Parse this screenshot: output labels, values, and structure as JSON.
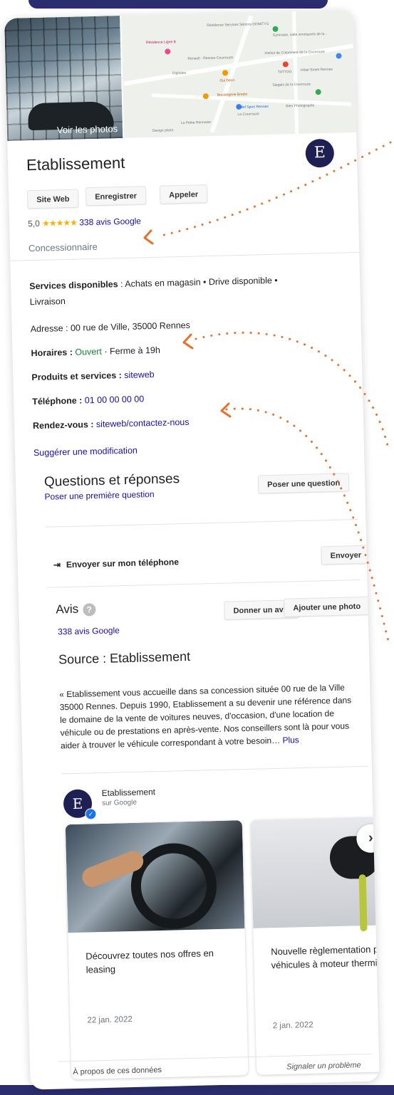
{
  "header": {
    "see_photos": "Voir les photos",
    "title": "Etablissement",
    "logo_letter": "E"
  },
  "map": {
    "labels": [
      "Résidence Ligne B",
      "Résidence Services Séniors DOMITYS",
      "Renault - Rennes Courrouze",
      "Digitales",
      "Institut de Cotonniere de la Courrouze",
      "Gymnase, salle omnisports de la...",
      "TATTOO",
      "Hôtel Street Rennes",
      "Oui Déco",
      "Boulangerie Bredin",
      "Odiel Sport Rennes",
      "La Courrouze",
      "Bien Photographe",
      "La Petite Rennaise",
      "Design photo",
      "Siegels de la Courrouze"
    ]
  },
  "actions": {
    "site_web": "Site Web",
    "enregistrer": "Enregistrer",
    "appeler": "Appeler"
  },
  "rating": {
    "score": "5,0",
    "stars": "★★★★★",
    "reviews_link": "338 avis Google",
    "value": 5.0
  },
  "category": "Concessionnaire",
  "info": {
    "services_label": "Services disponibles",
    "services_value": " : Achats en magasin • Drive disponible •",
    "services_value2": "Livraison",
    "address": "Adresse : 00 rue de Ville, 35000 Rennes",
    "hours_label": "Horaires : ",
    "hours_open": "Ouvert",
    "hours_close": " · Ferme à 19h",
    "products_label": "Produits et services : ",
    "products_value": "siteweb",
    "phone_label": "Téléphone : ",
    "phone_value": "01 00 00 00 00",
    "appointment_label": "Rendez-vous : ",
    "appointment_value": "siteweb/contactez-nous",
    "suggest_edit": "Suggérer une modification"
  },
  "qa": {
    "title": "Questions et réponses",
    "first_question": "Poser une première question",
    "ask_button": "Poser une question"
  },
  "send": {
    "label": "Envoyer sur mon téléphone",
    "button": "Envoyer"
  },
  "reviews": {
    "title": "Avis",
    "help": "?",
    "give_review": "Donner un avis",
    "add_photo": "Ajouter une photo",
    "count_link": "338 avis Google"
  },
  "source": {
    "title": "Source : Etablissement",
    "text": "« Etablissement  vous accueille dans sa concession située 00 rue de la Ville 35000 Rennes. Depuis 1990, Etablissement a su devenir une référence dans le domaine de la vente de voitures neuves, d'occasion, d'une location de véhicule ou de prestations en après-vente. Nos conseillers sont là pour vous aider à trouver le véhicule correspondant à votre besoin… ",
    "more": "Plus"
  },
  "posts": {
    "author": "Etablissement",
    "author_logo": "E",
    "on_google": "sur Google",
    "items": [
      {
        "text": "Découvrez toutes nos offres en leasing",
        "date": "22 jan. 2022"
      },
      {
        "text": "Nouvelle règlementation pour les véhicules à moteur thermique",
        "date": "2 jan. 2022"
      }
    ]
  },
  "footer": {
    "about": "À propos de ces données",
    "report": "Signaler un problème"
  },
  "colors": {
    "accent_orange": "#e8702a",
    "navy": "#1e1f52",
    "link_blue": "#1a0dab",
    "open_green": "#188038",
    "star_gold": "#f4b400"
  }
}
